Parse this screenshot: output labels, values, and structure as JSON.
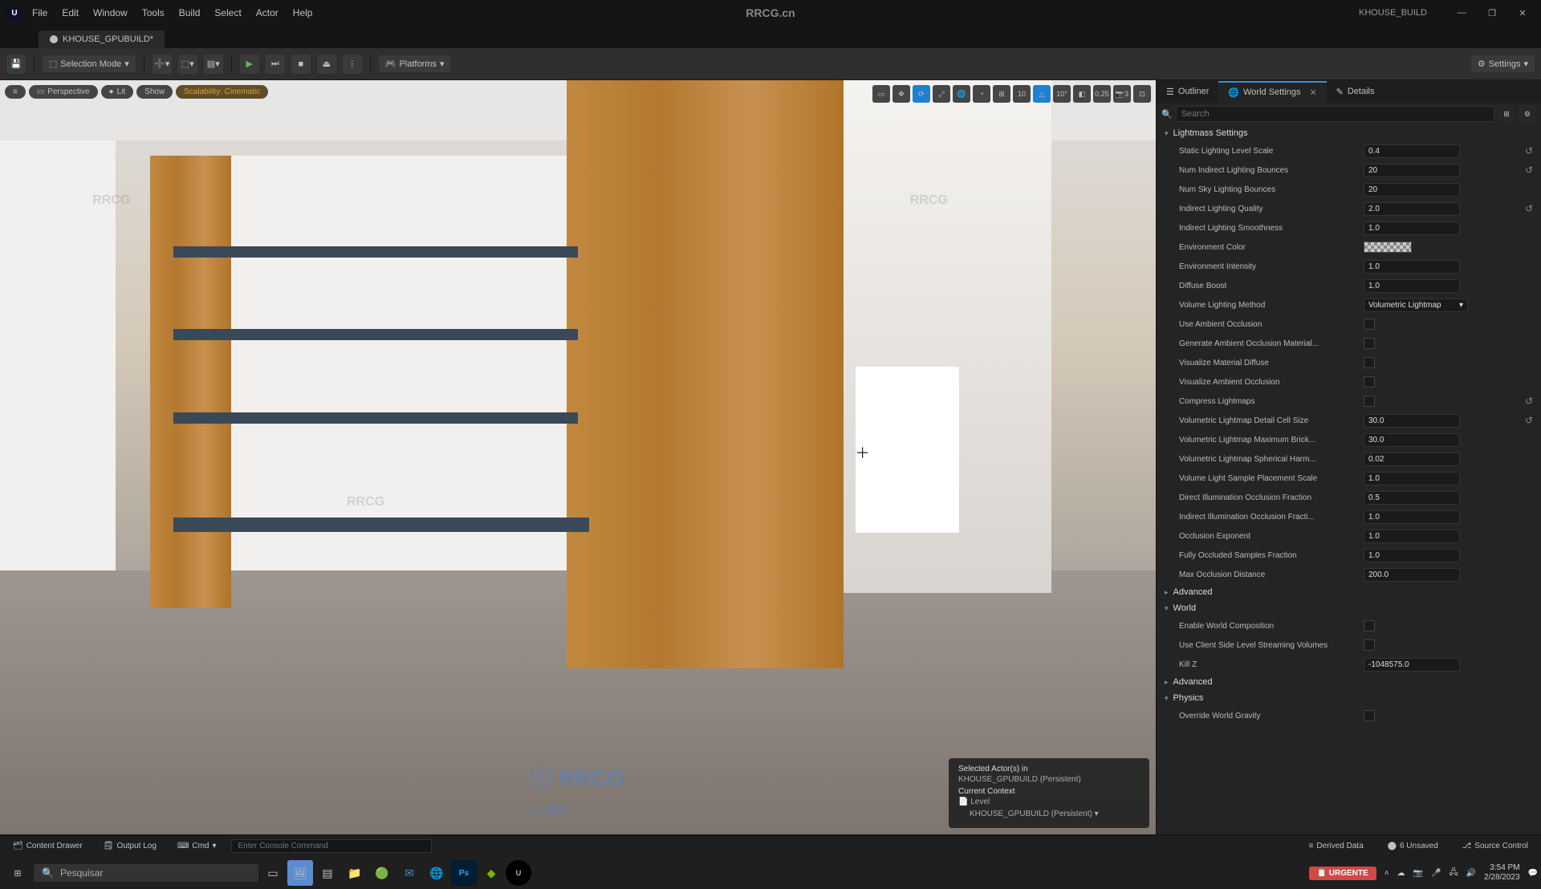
{
  "titlebar": {
    "menus": [
      "File",
      "Edit",
      "Window",
      "Tools",
      "Build",
      "Select",
      "Actor",
      "Help"
    ],
    "center": "RRCG.cn",
    "project": "KHOUSE_BUILD"
  },
  "tab": {
    "label": "KHOUSE_GPUBUILD*"
  },
  "toolbar": {
    "mode": "Selection Mode",
    "platforms": "Platforms",
    "settings": "Settings"
  },
  "viewport": {
    "left": {
      "hamburger": "≡",
      "perspective": "Perspective",
      "lit": "Lit",
      "show": "Show",
      "scalability": "Scalability: Cinematic"
    },
    "right": {
      "grid": "10",
      "angle": "10°",
      "scale": "0.25",
      "cam": "3"
    },
    "context": {
      "l1": "Selected Actor(s) in",
      "l2": "KHOUSE_GPUBUILD (Persistent)",
      "l3": "Current Context",
      "l4": "Level",
      "l5": "KHOUSE_GPUBUILD (Persistent)"
    }
  },
  "rp": {
    "tabs": {
      "outliner": "Outliner",
      "world": "World Settings",
      "details": "Details"
    },
    "search_placeholder": "Search",
    "cats": {
      "lightmass": "Lightmass Settings",
      "advanced": "Advanced",
      "world": "World",
      "physics": "Physics"
    },
    "rows": [
      {
        "k": "static_lighting_level_scale",
        "l": "Static Lighting Level Scale",
        "v": "0.4",
        "r": true
      },
      {
        "k": "num_indirect_bounces",
        "l": "Num Indirect Lighting Bounces",
        "v": "20",
        "r": true
      },
      {
        "k": "num_sky_bounces",
        "l": "Num Sky Lighting Bounces",
        "v": "20"
      },
      {
        "k": "indirect_quality",
        "l": "Indirect Lighting Quality",
        "v": "2.0",
        "r": true
      },
      {
        "k": "indirect_smoothness",
        "l": "Indirect Lighting Smoothness",
        "v": "1.0"
      },
      {
        "k": "env_color",
        "l": "Environment Color",
        "type": "color"
      },
      {
        "k": "env_intensity",
        "l": "Environment Intensity",
        "v": "1.0"
      },
      {
        "k": "diffuse_boost",
        "l": "Diffuse Boost",
        "v": "1.0"
      },
      {
        "k": "vol_method",
        "l": "Volume Lighting Method",
        "v": "Volumetric Lightmap",
        "type": "select"
      },
      {
        "k": "use_ao",
        "l": "Use Ambient Occlusion",
        "type": "check"
      },
      {
        "k": "gen_ao_mat",
        "l": "Generate Ambient Occlusion Material...",
        "type": "check"
      },
      {
        "k": "vis_mat_diffuse",
        "l": "Visualize Material Diffuse",
        "type": "check"
      },
      {
        "k": "vis_ao",
        "l": "Visualize Ambient Occlusion",
        "type": "check"
      },
      {
        "k": "compress_lm",
        "l": "Compress Lightmaps",
        "type": "check",
        "r": true
      },
      {
        "k": "vlm_cell",
        "l": "Volumetric Lightmap Detail Cell Size",
        "v": "30.0",
        "r": true
      },
      {
        "k": "vlm_brick",
        "l": "Volumetric Lightmap Maximum Brick...",
        "v": "30.0"
      },
      {
        "k": "vlm_harm",
        "l": "Volumetric Lightmap Spherical Harm...",
        "v": "0.02"
      },
      {
        "k": "vls_scale",
        "l": "Volume Light Sample Placement Scale",
        "v": "1.0"
      },
      {
        "k": "direct_occ",
        "l": "Direct Illumination Occlusion Fraction",
        "v": "0.5"
      },
      {
        "k": "indirect_occ",
        "l": "Indirect Illumination Occlusion Fracti...",
        "v": "1.0"
      },
      {
        "k": "occ_exp",
        "l": "Occlusion Exponent",
        "v": "1.0"
      },
      {
        "k": "full_occ",
        "l": "Fully Occluded Samples Fraction",
        "v": "1.0"
      },
      {
        "k": "max_occ_dist",
        "l": "Max Occlusion Distance",
        "v": "200.0"
      }
    ],
    "world_rows": [
      {
        "k": "enable_world_comp",
        "l": "Enable World Composition",
        "type": "check"
      },
      {
        "k": "client_side_stream",
        "l": "Use Client Side Level Streaming Volumes",
        "type": "check"
      },
      {
        "k": "kill_z",
        "l": "Kill Z",
        "v": "-1048575.0"
      }
    ],
    "physics_rows": [
      {
        "k": "override_gravity",
        "l": "Override World Gravity",
        "type": "check"
      }
    ]
  },
  "bottom": {
    "drawer": "Content Drawer",
    "output": "Output Log",
    "cmd": "Cmd",
    "cmd_ph": "Enter Console Command",
    "derived": "Derived Data",
    "unsaved": "6 Unsaved",
    "source": "Source Control"
  },
  "taskbar": {
    "search": "Pesquisar",
    "urgente": "URGENTE",
    "time": "3:54 PM",
    "date": "2/28/2023"
  }
}
